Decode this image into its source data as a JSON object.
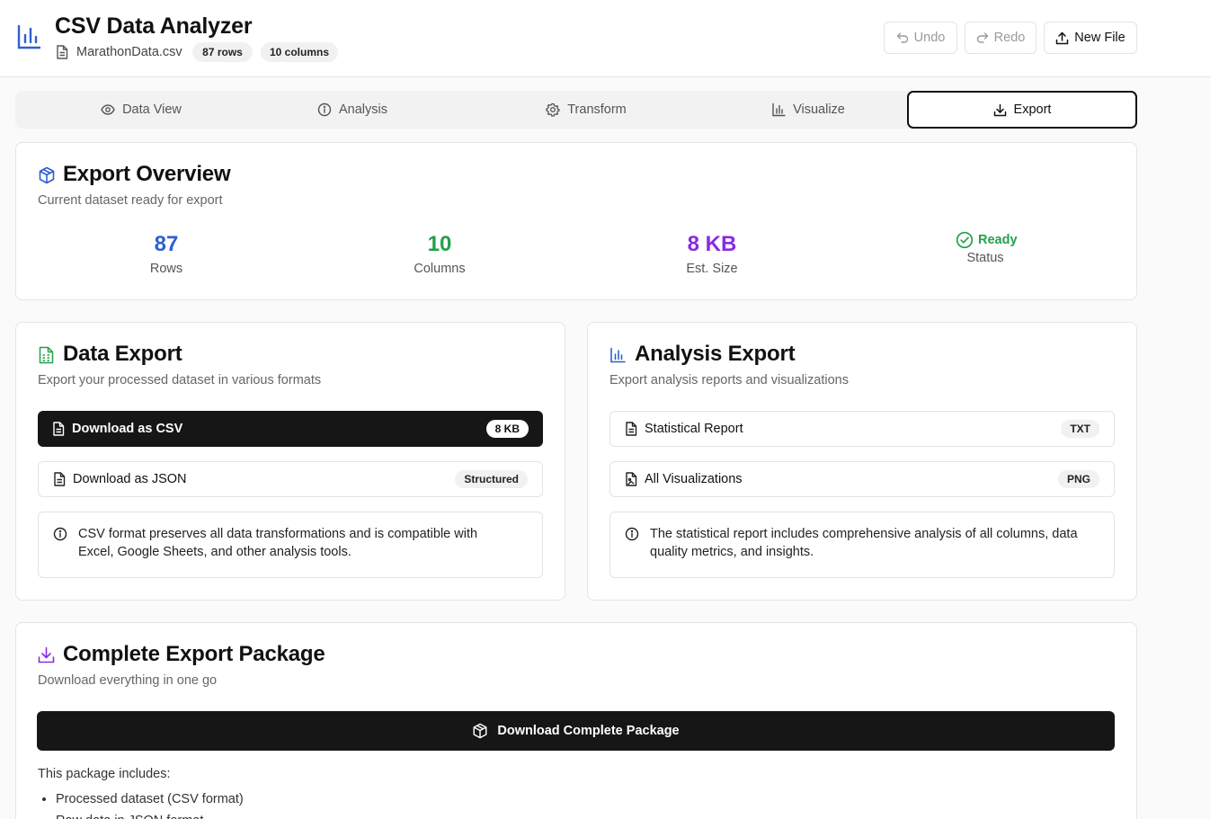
{
  "app": {
    "title": "CSV Data Analyzer"
  },
  "file": {
    "name": "MarathonData.csv",
    "rows_badge": "87 rows",
    "cols_badge": "10 columns"
  },
  "header_actions": {
    "undo": "Undo",
    "redo": "Redo",
    "new_file": "New File"
  },
  "tabs": [
    {
      "label": "Data View",
      "icon": "eye-icon"
    },
    {
      "label": "Analysis",
      "icon": "info-icon"
    },
    {
      "label": "Transform",
      "icon": "gear-icon"
    },
    {
      "label": "Visualize",
      "icon": "bar-chart-icon"
    },
    {
      "label": "Export",
      "icon": "download-icon",
      "active": true
    }
  ],
  "overview": {
    "title": "Export Overview",
    "subtitle": "Current dataset ready for export",
    "rows_value": "87",
    "rows_label": "Rows",
    "cols_value": "10",
    "cols_label": "Columns",
    "size_value": "8 KB",
    "size_label": "Est. Size",
    "status_value": "Ready",
    "status_label": "Status"
  },
  "data_export": {
    "title": "Data Export",
    "subtitle": "Export your processed dataset in various formats",
    "csv_label": "Download as CSV",
    "csv_badge": "8 KB",
    "json_label": "Download as JSON",
    "json_badge": "Structured",
    "note_line1": "CSV format preserves all data transformations and is compatible with",
    "note_line2": "Excel, Google Sheets, and other analysis tools."
  },
  "analysis_export": {
    "title": "Analysis Export",
    "subtitle": "Export analysis reports and visualizations",
    "report_label": "Statistical Report",
    "report_badge": "TXT",
    "viz_label": "All Visualizations",
    "viz_badge": "PNG",
    "note_line1": "The statistical report includes comprehensive analysis of all columns, data",
    "note_line2": "quality metrics, and insights."
  },
  "package": {
    "title": "Complete Export Package",
    "subtitle": "Download everything in one go",
    "button": "Download Complete Package",
    "includes_label": "This package includes:",
    "items": [
      "Processed dataset (CSV format)",
      "Raw data in JSON format"
    ]
  },
  "colors": {
    "blue": "#2f5fd0",
    "green": "#23a04b",
    "purple": "#8a2be2",
    "dark": "#161616"
  }
}
